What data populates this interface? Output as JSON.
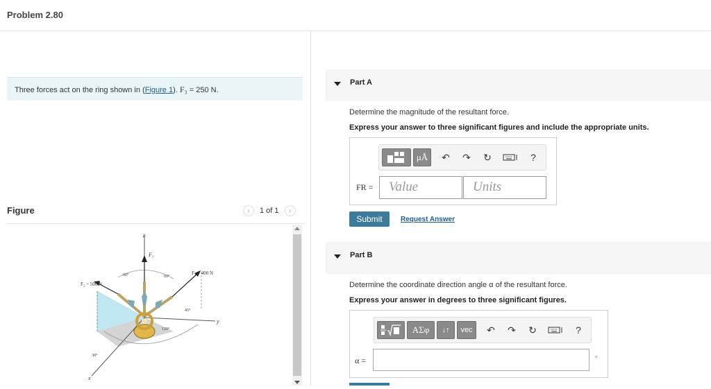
{
  "problem": {
    "title": "Problem 2.80"
  },
  "statement": {
    "prefix": "Three forces act on the ring shown in (",
    "link": "Figure 1",
    "mid": "). ",
    "math": "F₃",
    "suffix": " = 250 N."
  },
  "figure": {
    "label": "Figure",
    "pager": "1 of 1",
    "labels": {
      "z": "z",
      "y": "y",
      "x": "x",
      "f3": "F₃",
      "f1": "F₁ = 400 N",
      "f2": "F₂ = 500 N",
      "a60a": "60°",
      "a60b": "60°",
      "a45": "45°",
      "a120": "120°",
      "a30": "30°"
    }
  },
  "partA": {
    "title": "Part A",
    "question": "Determine the magnitude of the resultant force.",
    "instruction": "Express your answer to three significant figures and include the appropriate units.",
    "toolbar": {
      "units_btn": "μÅ",
      "help": "?"
    },
    "var_label": "FR =",
    "value_placeholder": "Value",
    "units_placeholder": "Units",
    "submit": "Submit",
    "request": "Request Answer"
  },
  "partB": {
    "title": "Part B",
    "question": "Determine the coordinate direction angle α of the resultant force.",
    "instruction": "Express your answer in degrees to three significant figures.",
    "toolbar": {
      "greek_btn": "ΑΣφ",
      "arrows_btn": "↓↑",
      "vec_btn": "vec",
      "help": "?"
    },
    "var_label": "α =",
    "unit_mark": "∘"
  }
}
